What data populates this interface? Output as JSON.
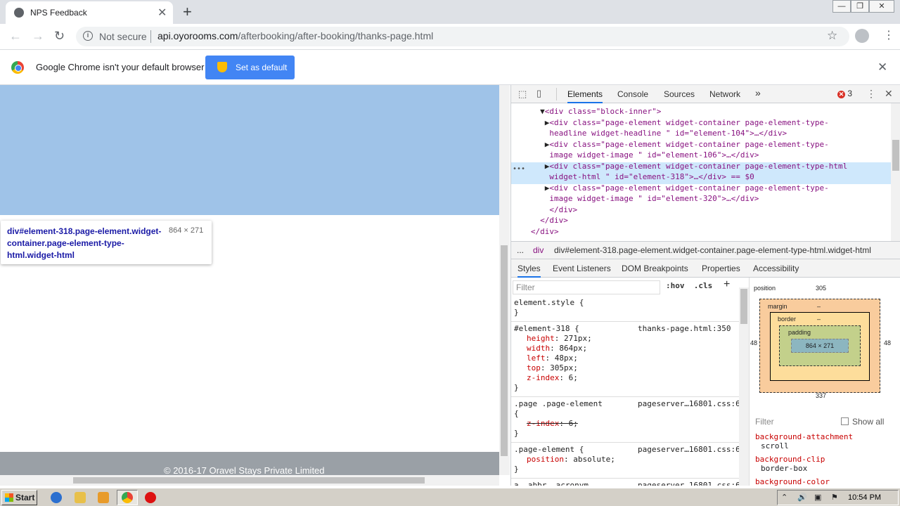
{
  "browser": {
    "tab_title": "NPS Feedback",
    "tab_close": "✕",
    "new_tab": "+",
    "nav": {
      "back": "←",
      "forward": "→",
      "reload": "↻"
    },
    "security_text": "Not secure",
    "url_host": "api.oyorooms.com",
    "url_path": "/afterbooking/after-booking/thanks-page.html",
    "window_buttons": [
      "—",
      "❐",
      "✕"
    ],
    "infobar": {
      "message": "Google Chrome isn't your default browser",
      "button": "Set as default"
    }
  },
  "page": {
    "highlight_color": "#9fc3e8",
    "tooltip": {
      "tag": "div",
      "selector": "#element-318.page-element.widget-container.page-element-type-html.widget-html",
      "size": "864 × 271"
    },
    "footer": "© 2016-17 Oravel Stays Private Limited"
  },
  "devtools": {
    "tabs": [
      "Elements",
      "Console",
      "Sources",
      "Network",
      "»"
    ],
    "error_count": "3",
    "dom_lines": [
      {
        "indent": "     ",
        "arrow": "▼",
        "text": "<div class=\"block-inner\">"
      },
      {
        "indent": "      ",
        "arrow": "▶",
        "text": "<div class=\"page-element widget-container page-element-type-"
      },
      {
        "indent": "       ",
        "arrow": "",
        "text": "headline widget-headline \" id=\"element-104\">…</div>"
      },
      {
        "indent": "      ",
        "arrow": "▶",
        "text": "<div class=\"page-element widget-container page-element-type-"
      },
      {
        "indent": "       ",
        "arrow": "",
        "text": "image widget-image \" id=\"element-106\">…</div>"
      },
      {
        "indent": "      ",
        "arrow": "▶",
        "text": "<div class=\"page-element widget-container page-element-type-html"
      },
      {
        "indent": "       ",
        "arrow": "",
        "text": "widget-html \" id=\"element-318\">…</div> == $0"
      },
      {
        "indent": "      ",
        "arrow": "▶",
        "text": "<div class=\"page-element widget-container page-element-type-"
      },
      {
        "indent": "       ",
        "arrow": "",
        "text": "image widget-image \" id=\"element-320\">…</div>"
      },
      {
        "indent": "       ",
        "arrow": "",
        "text": "</div>"
      },
      {
        "indent": "     ",
        "arrow": "",
        "text": "</div>"
      },
      {
        "indent": "   ",
        "arrow": "",
        "text": "</div>"
      }
    ],
    "breadcrumbs": [
      "...",
      "div",
      "div#element-318.page-element.widget-container.page-element-type-html.widget-html"
    ],
    "styles_tabs": [
      "Styles",
      "Event Listeners",
      "DOM Breakpoints",
      "Properties",
      "Accessibility"
    ],
    "filter_placeholder": "Filter",
    "hov": ":hov",
    "cls": ".cls",
    "rules": [
      {
        "selector": "element.style {",
        "source": "",
        "props": [],
        "close": "}"
      },
      {
        "selector": "#element-318 {",
        "source": "thanks-page.html:350",
        "props": [
          [
            "height",
            "271px;"
          ],
          [
            "width",
            "864px;"
          ],
          [
            "left",
            "48px;"
          ],
          [
            "top",
            "305px;"
          ],
          [
            "z-index",
            "6;"
          ]
        ],
        "close": "}"
      },
      {
        "selector": ".page .page-element",
        "source": "pageserver…16801.css:6",
        "props": [
          [
            "{",
            ""
          ],
          [
            "z-index",
            "6;"
          ]
        ],
        "close": "}"
      },
      {
        "selector": ".page-element {",
        "source": "pageserver…16801.css:6",
        "props": [
          [
            "position",
            "absolute;"
          ]
        ],
        "close": "}"
      },
      {
        "selector": "a, abbr, acronym,",
        "source": "pageserver…16801.css:6",
        "props": [],
        "close": ""
      }
    ],
    "box_model": {
      "position_label": "position",
      "position_top": "305",
      "position_bottom": "337",
      "position_side": "48",
      "margin_label": "margin",
      "border_label": "border",
      "padding_label": "padding",
      "dash": "–",
      "content": "864 × 271"
    },
    "computed_filter": "Filter",
    "show_all": "Show all",
    "computed": [
      {
        "name": "background-attachment",
        "value": "scroll"
      },
      {
        "name": "background-clip",
        "value": "border-box"
      },
      {
        "name": "background-color",
        "value": ""
      }
    ]
  },
  "taskbar": {
    "start": "Start",
    "clock": "10:54 PM"
  }
}
